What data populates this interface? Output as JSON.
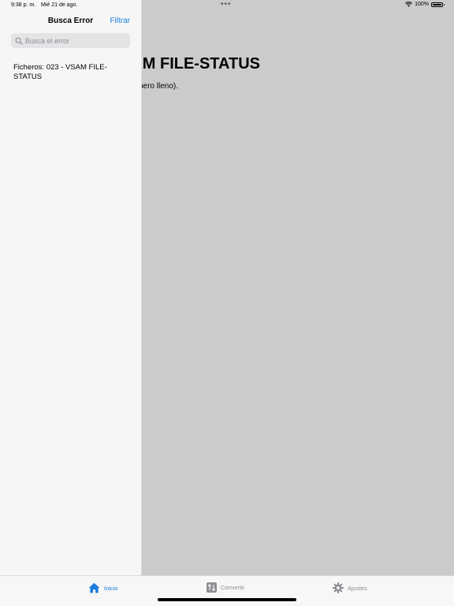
{
  "status_bar": {
    "time": "9:38 p. m.",
    "date": "Mié 21 de ago.",
    "dots": "•••",
    "battery": "100%"
  },
  "sidebar": {
    "title": "Busca Error",
    "filter_label": "Filtrar",
    "search_placeholder": "Busca el error",
    "items": [
      {
        "label": "Ficheros:  023 - VSAM FILE-STATUS"
      }
    ]
  },
  "detail": {
    "title_visible": "AM FILE-STATUS",
    "text_visible": "hero lleno)."
  },
  "tabbar": {
    "tabs": [
      {
        "label": "Inicio",
        "icon": "house-icon",
        "active": true
      },
      {
        "label": "Convertir",
        "icon": "convert-icon",
        "active": false
      },
      {
        "label": "Ajustes",
        "icon": "gear-icon",
        "active": false
      }
    ]
  },
  "colors": {
    "accent": "#1a7de0",
    "sidebar_bg": "#f6f6f6",
    "detail_bg": "#cbcbcb",
    "inactive": "#8e8e93"
  }
}
